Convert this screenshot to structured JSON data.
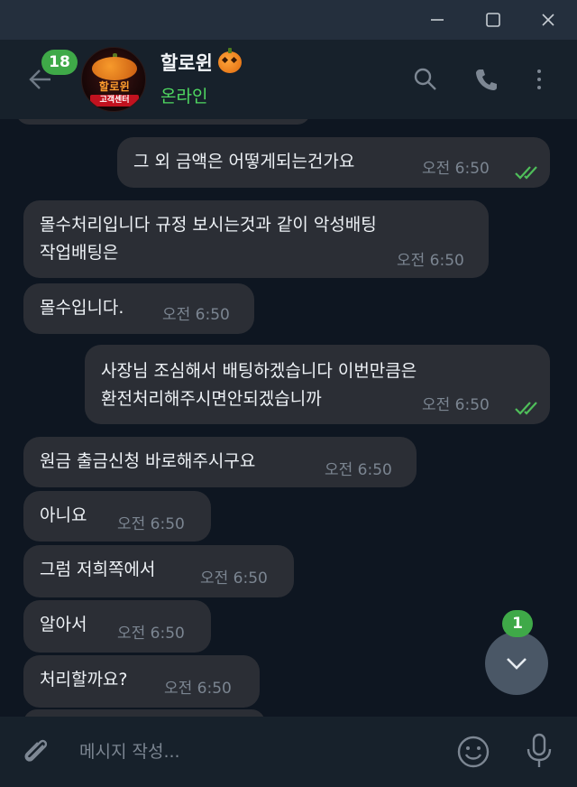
{
  "window": {
    "controls": [
      {
        "name": "minimize-icon"
      },
      {
        "name": "maximize-icon"
      },
      {
        "name": "close-icon"
      }
    ]
  },
  "header": {
    "unread_count": "18",
    "avatar": {
      "line1": "할로윈",
      "line2": "고객센터"
    },
    "title": "할로윈",
    "title_icon": "pumpkin-icon",
    "status": "온라인",
    "status_color": "#4fd861",
    "icons": [
      "search-icon",
      "phone-icon",
      "more-vertical-icon"
    ]
  },
  "messages": [
    {
      "dir": "out",
      "text": "그 외 금액은 어떻게되는건가요",
      "time": "오전 6:50",
      "read": true
    },
    {
      "dir": "in",
      "text": "몰수처리입니다 규정 보시는것과 같이 악성배팅\n작업배팅은",
      "time": "오전 6:50"
    },
    {
      "dir": "in",
      "text": "몰수입니다.",
      "time": "오전 6:50"
    },
    {
      "dir": "out",
      "text": "사장님 조심해서 배팅하겠습니다 이번만큼은\n환전처리해주시면안되겠습니까",
      "time": "오전 6:50",
      "read": true
    },
    {
      "dir": "in",
      "text": "원금 출금신청 바로해주시구요",
      "time": "오전 6:50"
    },
    {
      "dir": "in",
      "text": "아니요",
      "time": "오전 6:50"
    },
    {
      "dir": "in",
      "text": "그럼 저희쪽에서",
      "time": "오전 6:50"
    },
    {
      "dir": "in",
      "text": "알아서",
      "time": "오전 6:50"
    },
    {
      "dir": "in",
      "text": "처리할까요?",
      "time": "오전 6:50"
    }
  ],
  "scroll_down": {
    "badge": "1"
  },
  "composer": {
    "placeholder": "메시지 작성...",
    "icons": [
      "paperclip-icon",
      "emoji-icon",
      "microphone-icon"
    ]
  },
  "colors": {
    "accent_green": "#3fa948",
    "read_check": "#4fbe5a",
    "bubble": "#2b2e35",
    "background": "#0e1621",
    "header": "#17212b"
  }
}
